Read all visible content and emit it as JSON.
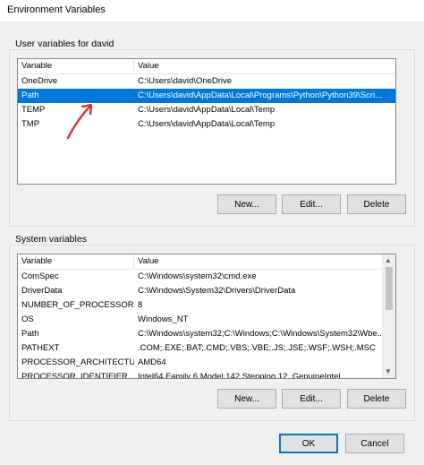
{
  "window": {
    "title": "Environment Variables"
  },
  "user": {
    "group_label": "User variables for david",
    "headers": [
      "Variable",
      "Value"
    ],
    "rows": [
      [
        "OneDrive",
        "C:\\Users\\david\\OneDrive"
      ],
      [
        "Path",
        "C:\\Users\\david\\AppData\\Local\\Programs\\Python\\Python39\\Scri..."
      ],
      [
        "TEMP",
        "C:\\Users\\david\\AppData\\Local\\Temp"
      ],
      [
        "TMP",
        "C:\\Users\\david\\AppData\\Local\\Temp"
      ]
    ],
    "buttons": {
      "new": "New...",
      "edit": "Edit...",
      "delete": "Delete"
    }
  },
  "system": {
    "group_label": "System variables",
    "headers": [
      "Variable",
      "Value"
    ],
    "rows": [
      [
        "ComSpec",
        "C:\\Windows\\system32\\cmd.exe"
      ],
      [
        "DriverData",
        "C:\\Windows\\System32\\Drivers\\DriverData"
      ],
      [
        "NUMBER_OF_PROCESSORS",
        "8"
      ],
      [
        "OS",
        "Windows_NT"
      ],
      [
        "Path",
        "C:\\Windows\\system32;C:\\Windows;C:\\Windows\\System32\\Wbe..."
      ],
      [
        "PATHEXT",
        ".COM;.EXE;.BAT;.CMD;.VBS;.VBE;.JS;.JSE;.WSF;.WSH;.MSC"
      ],
      [
        "PROCESSOR_ARCHITECTURE",
        "AMD64"
      ],
      [
        "PROCESSOR_IDENTIFIER",
        "Intel64 Family 6 Model 142 Stepping 12, GenuineIntel"
      ]
    ],
    "buttons": {
      "new": "New...",
      "edit": "Edit...",
      "delete": "Delete"
    }
  },
  "footer": {
    "ok": "OK",
    "cancel": "Cancel"
  },
  "colors": {
    "selection": "#0078d7",
    "annotation_arrow": "#d9302c"
  }
}
